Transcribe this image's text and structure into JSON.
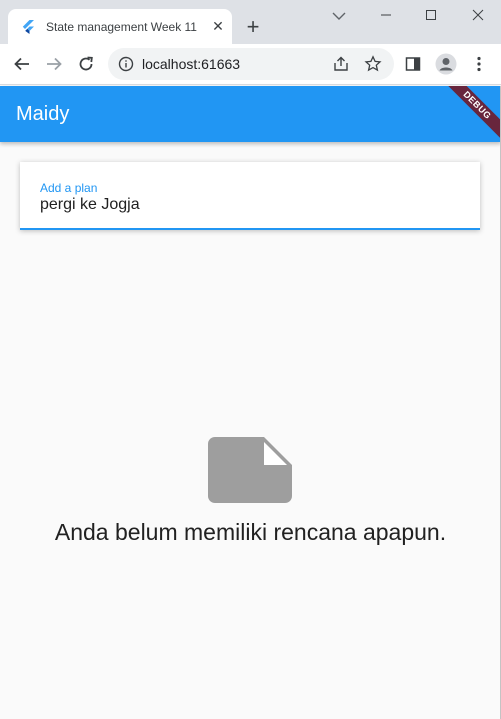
{
  "browser": {
    "tab_title": "State management Week 11",
    "tab_close": "✕",
    "new_tab": "+",
    "url": "localhost:61663"
  },
  "app": {
    "title": "Maidy",
    "debug_banner": "DEBUG",
    "accent_color": "#2196f3"
  },
  "plan_input": {
    "label": "Add a plan",
    "value": "pergi ke Jogja"
  },
  "empty_state": {
    "icon": "note-icon",
    "message": "Anda belum memiliki rencana apapun."
  }
}
